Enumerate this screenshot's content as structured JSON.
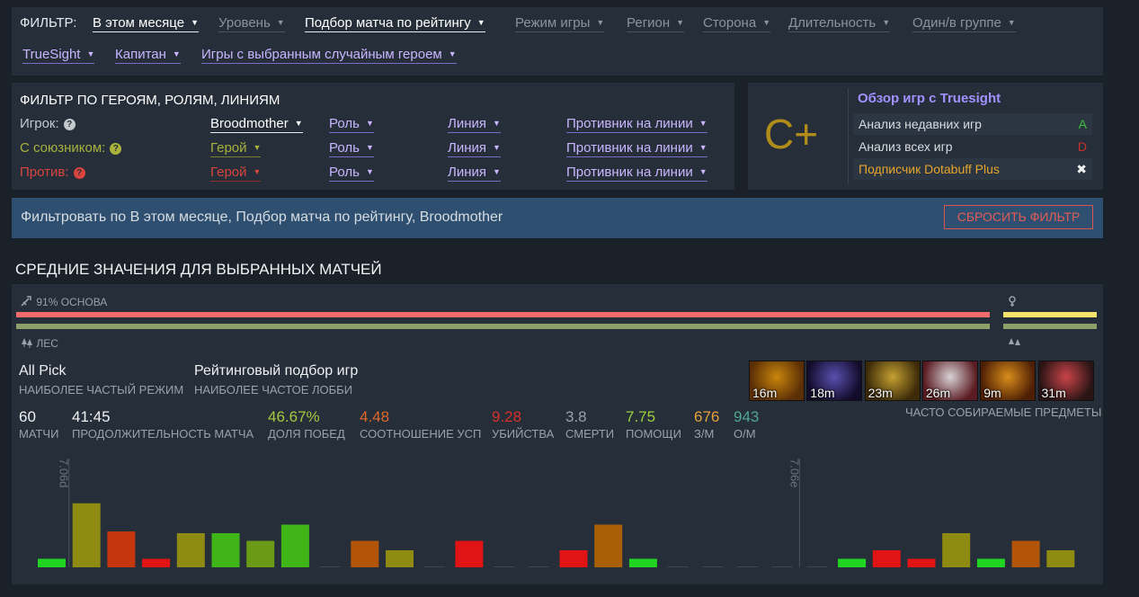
{
  "filter_bar": {
    "label": "ФИЛЬТР:",
    "row1": [
      {
        "name": "filter-date",
        "label": "В этом месяце",
        "state": "on"
      },
      {
        "name": "filter-level",
        "label": "Уровень",
        "state": "off"
      },
      {
        "name": "filter-matchmaking",
        "label": "Подбор матча по рейтингу",
        "state": "on"
      },
      {
        "name": "filter-game-mode",
        "label": "Режим игры",
        "state": "off"
      },
      {
        "name": "filter-region",
        "label": "Регион",
        "state": "off"
      },
      {
        "name": "filter-side",
        "label": "Сторона",
        "state": "off"
      },
      {
        "name": "filter-duration",
        "label": "Длительность",
        "state": "off"
      },
      {
        "name": "filter-party",
        "label": "Один/в группе",
        "state": "off"
      }
    ],
    "row2": [
      {
        "name": "filter-truesight",
        "label": "TrueSight",
        "state": "purple"
      },
      {
        "name": "filter-captain",
        "label": "Капитан",
        "state": "purple"
      },
      {
        "name": "filter-random-hero",
        "label": "Игры с выбранным случайным героем",
        "state": "purple"
      }
    ]
  },
  "hero_filter": {
    "title": "ФИЛЬТР ПО ГЕРОЯМ, РОЛЯМ, ЛИНИЯМ",
    "rows": [
      {
        "label": "Игрок:",
        "hero": "Broodmother",
        "role": "Роль",
        "lane": "Линия",
        "opponent": "Противник на линии"
      },
      {
        "label": "С союзником:",
        "hero": "Герой",
        "role": "Роль",
        "lane": "Линия",
        "opponent": "Противник на линии"
      },
      {
        "label": "Против:",
        "hero": "Герой",
        "role": "Роль",
        "lane": "Линия",
        "opponent": "Противник на линии"
      }
    ]
  },
  "truesight": {
    "grade": "C+",
    "title": "Обзор игр с Truesight",
    "rows": [
      {
        "label": "Анализ недавних игр",
        "value": "A",
        "color": "#3fbf3f"
      },
      {
        "label": "Анализ всех игр",
        "value": "D",
        "color": "#c9302c"
      },
      {
        "label": "Подписчик Dotabuff Plus",
        "value": "✖",
        "color": "#f0f0f0"
      }
    ]
  },
  "banner": {
    "text": "Фильтровать по В этом месяце, Подбор матча по рейтингу, Broodmother",
    "reset_label": "СБРОСИТЬ ФИЛЬТР"
  },
  "averages": {
    "title": "СРЕДНИЕ ЗНАЧЕНИЯ ДЛЯ ВЫБРАННЫХ МАТЧЕЙ",
    "core_label": "91% ОСНОВА",
    "core_percent": 91,
    "jungle_label": "ЛЕС",
    "mode_value": "All Pick",
    "mode_label": "НАИБОЛЕЕ ЧАСТЫЙ РЕЖИМ",
    "lobby_value": "Рейтинговый подбор игр",
    "lobby_label": "НАИБОЛЕЕ ЧАСТОЕ ЛОББИ",
    "items_label": "ЧАСТО СОБИРАЕМЫЕ ПРЕДМЕТЫ",
    "items": [
      {
        "time": "16m",
        "icon": "golden-staff-item-icon",
        "c1": "#c8860c",
        "c2": "#5a2e06"
      },
      {
        "time": "18m",
        "icon": "purple-boots-item-icon",
        "c1": "#5b4fb0",
        "c2": "#120c2a"
      },
      {
        "time": "23m",
        "icon": "golden-helm-item-icon",
        "c1": "#c4a032",
        "c2": "#3c2a08"
      },
      {
        "time": "26m",
        "icon": "red-orb-item-icon",
        "c1": "#d8d2d6",
        "c2": "#5a1c22"
      },
      {
        "time": "9m",
        "icon": "fire-gauntlet-item-icon",
        "c1": "#d98d1c",
        "c2": "#4e1f04"
      },
      {
        "time": "31m",
        "icon": "crimson-armor-item-icon",
        "c1": "#c9444a",
        "c2": "#2a1414"
      }
    ],
    "stats": [
      {
        "value": "60",
        "label": "МАТЧИ",
        "color": "#eef0f2"
      },
      {
        "value": "41:45",
        "label": "ПРОДОЛЖИТЕЛЬНОСТЬ МАТЧА",
        "color": "#eef0f2"
      },
      {
        "value": "46.67%",
        "label": "ДОЛЯ ПОБЕД",
        "color": "#a5c93e"
      },
      {
        "value": "4.48",
        "label": "СООТНОШЕНИЕ УСП",
        "color": "#e0692b"
      },
      {
        "value": "9.28",
        "label": "УБИЙСТВА",
        "color": "#d9302c"
      },
      {
        "value": "3.8",
        "label": "СМЕРТИ",
        "color": "#9aa1a8"
      },
      {
        "value": "7.75",
        "label": "ПОМОЩИ",
        "color": "#9bcf3c"
      },
      {
        "value": "676",
        "label": "З/М",
        "color": "#e7a13a"
      },
      {
        "value": "943",
        "label": "О/М",
        "color": "#4fa88f"
      }
    ],
    "patch_labels": [
      "7.06d",
      "7.06e"
    ]
  },
  "chart_data": {
    "type": "bar",
    "values": [
      1,
      7.5,
      4.2,
      1,
      4,
      4,
      3.1,
      5,
      0,
      3.1,
      2,
      0,
      3.1,
      0,
      0,
      2,
      5,
      1,
      0,
      0,
      0,
      0,
      0,
      1,
      2,
      1,
      4,
      1,
      3.1,
      2
    ],
    "colors": [
      "#22d422",
      "#8e8a12",
      "#c6360e",
      "#e01414",
      "#8e8a12",
      "#3fb518",
      "#6a9a16",
      "#3fb518",
      "",
      "#b25508",
      "#8e8a12",
      "",
      "#e01414",
      "",
      "",
      "#e01414",
      "#a85f06",
      "#22d422",
      "",
      "",
      "",
      "",
      "",
      "#22d422",
      "#e01414",
      "#e01414",
      "#8e8a12",
      "#22d422",
      "#b25508",
      "#8e8a12"
    ],
    "patch_markers": [
      {
        "label": "7.06d",
        "before_index": 1
      },
      {
        "label": "7.06e",
        "before_index": 22
      }
    ]
  }
}
